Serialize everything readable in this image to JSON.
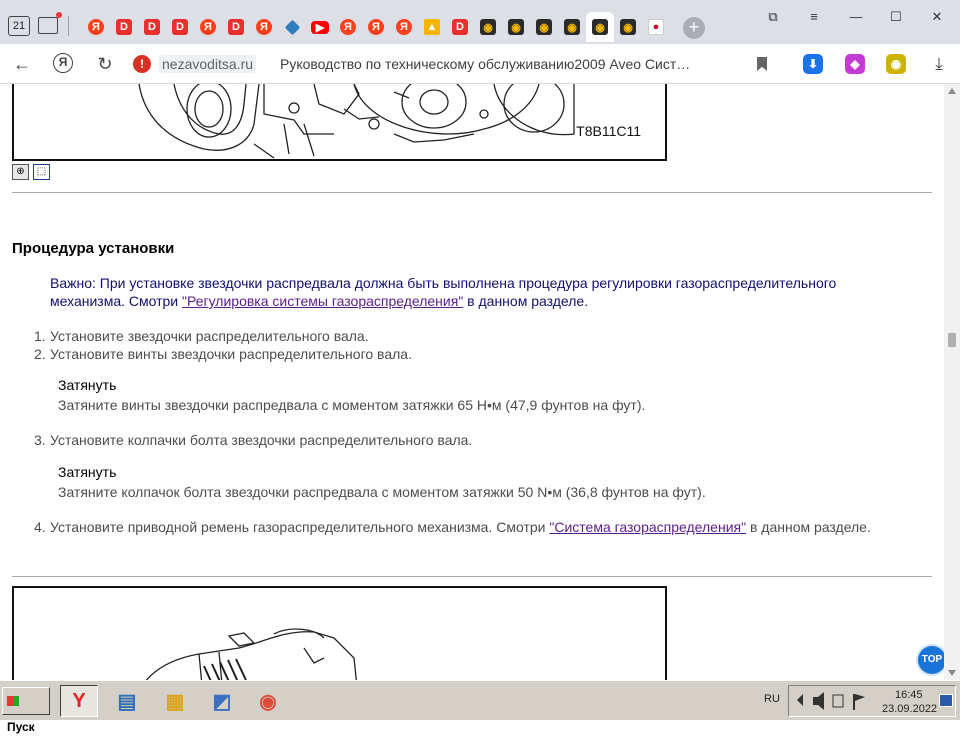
{
  "browser": {
    "tab_count": "21",
    "pinned_tabs": [
      {
        "icon": "yandex-icon",
        "glyph": "Я",
        "cls": "ya"
      },
      {
        "icon": "d-app-icon",
        "glyph": "D",
        "cls": "d"
      },
      {
        "icon": "d-app-icon",
        "glyph": "D",
        "cls": "d"
      },
      {
        "icon": "d-app-icon",
        "glyph": "D",
        "cls": "d"
      },
      {
        "icon": "yandex-icon",
        "glyph": "Я",
        "cls": "ya"
      },
      {
        "icon": "d-app-icon",
        "glyph": "D",
        "cls": "d"
      },
      {
        "icon": "yandex-icon",
        "glyph": "Я",
        "cls": "ya"
      },
      {
        "icon": "kite-icon",
        "glyph": "",
        "cls": "kite"
      },
      {
        "icon": "youtube-icon",
        "glyph": "▶",
        "cls": "yt"
      },
      {
        "icon": "yandex-icon",
        "glyph": "Я",
        "cls": "ya"
      },
      {
        "icon": "yandex-icon",
        "glyph": "Я",
        "cls": "ya"
      },
      {
        "icon": "yandex-icon",
        "glyph": "Я",
        "cls": "ya"
      },
      {
        "icon": "photo-icon",
        "glyph": "▲",
        "cls": "photo"
      },
      {
        "icon": "d-app-icon",
        "glyph": "D",
        "cls": "d"
      },
      {
        "icon": "car-site-icon",
        "glyph": "◉",
        "cls": "car"
      },
      {
        "icon": "car-site-icon",
        "glyph": "◉",
        "cls": "car"
      },
      {
        "icon": "car-site-icon",
        "glyph": "◉",
        "cls": "car"
      },
      {
        "icon": "car-site-icon",
        "glyph": "◉",
        "cls": "car"
      },
      {
        "icon": "car-site-icon",
        "glyph": "◉",
        "cls": "car",
        "active": true
      },
      {
        "icon": "car-site-icon",
        "glyph": "◉",
        "cls": "car"
      },
      {
        "icon": "korea-flag-icon",
        "glyph": "●",
        "cls": "kr"
      }
    ],
    "add_tab": "+",
    "window_buttons": {
      "collections": "⧉",
      "menu": "≡",
      "minimize": "—",
      "maximize": "☐",
      "close": "✕"
    },
    "url_domain": "nezavoditsa.ru",
    "url_title": "Руководство по техническому обслуживанию2009 Aveo Сист…",
    "extensions": [
      {
        "name": "download-ext-icon",
        "glyph": "⬇",
        "color": "#1a73e8"
      },
      {
        "name": "alice-ext-icon",
        "glyph": "◆",
        "color": "#c23bd4"
      },
      {
        "name": "car-ext-icon",
        "glyph": "◉",
        "color": "#c9b400"
      }
    ]
  },
  "page": {
    "figure_top_label": "T8B11C11",
    "zoom_in_glyph": "⊕",
    "zoom_select_glyph": "⬚",
    "heading": "Процедура установки",
    "note_prefix": "Важно: При установке звездочки распредвала должна быть выполнена процедура регулировки газораспределительного механизма. Смотри ",
    "note_link": "\"Регулировка системы газораспределения\"",
    "note_suffix": " в данном разделе.",
    "steps": [
      {
        "n": "1.",
        "text": "Установите звездочки распределительного вала."
      },
      {
        "n": "2.",
        "text": "Установите винты звездочки распределительного вала."
      },
      {
        "n": "3.",
        "text": "Установите колпачки болта звездочки распределительного вала."
      },
      {
        "n": "4.",
        "text": "Установите приводной ремень газораспределительного механизма. Смотри ",
        "link": "\"Система газораспределения\"",
        "suffix": " в данном разделе."
      }
    ],
    "tighten_1_title": "Затянуть",
    "tighten_1_text": "Затяните винты звездочки распредвала с моментом затяжки 65 Н•м (47,9 фунтов на фут).",
    "tighten_2_title": "Затянуть",
    "tighten_2_text": "Затяните колпачок болта звездочки распредвала с моментом затяжки 50 N•м (36,8 фунтов на фут).",
    "top_button": "TOP"
  },
  "taskbar": {
    "start_label": "Пуск",
    "apps": [
      {
        "name": "yandex-browser-app",
        "glyph": "Y",
        "color": "#e52620",
        "active": true
      },
      {
        "name": "explorer-window-app",
        "glyph": "▤",
        "color": "#2f6db5"
      },
      {
        "name": "file-manager-app",
        "glyph": "▦",
        "color": "#d9a520"
      },
      {
        "name": "presentation-app",
        "glyph": "◩",
        "color": "#3a6fc4"
      },
      {
        "name": "chrome-app",
        "glyph": "◉",
        "color": "#dd4b39"
      }
    ],
    "language": "RU",
    "time": "16:45",
    "date": "23.09.2022"
  }
}
